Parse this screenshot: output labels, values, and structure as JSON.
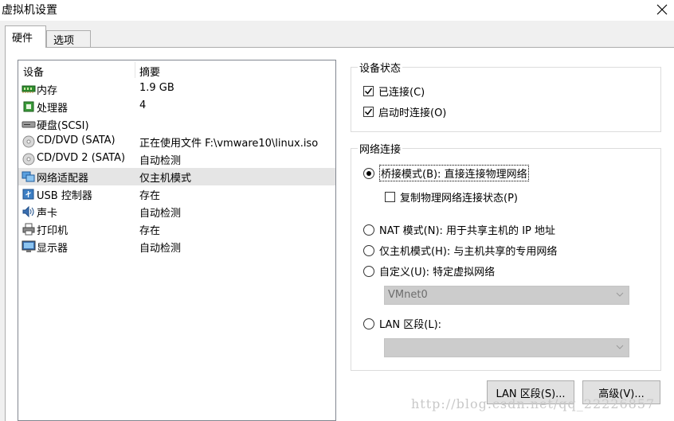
{
  "window": {
    "title": "虚拟机设置"
  },
  "tabs": [
    {
      "label": "硬件"
    },
    {
      "label": "选项"
    }
  ],
  "device_list": {
    "headers": {
      "device": "设备",
      "summary": "摘要"
    },
    "rows": [
      {
        "name": "内存",
        "summary": "1.9 GB",
        "icon": "memory-icon"
      },
      {
        "name": "处理器",
        "summary": "4",
        "icon": "processor-icon"
      },
      {
        "name": "硬盘(SCSI)",
        "summary": "",
        "icon": "hard-disk-icon"
      },
      {
        "name": "CD/DVD (SATA)",
        "summary": "正在使用文件 F:\\vmware10\\linux.iso",
        "icon": "cd-dvd-icon"
      },
      {
        "name": "CD/DVD 2 (SATA)",
        "summary": "自动检测",
        "icon": "cd-dvd-icon"
      },
      {
        "name": "网络适配器",
        "summary": "仅主机模式",
        "icon": "network-adapter-icon"
      },
      {
        "name": "USB 控制器",
        "summary": "存在",
        "icon": "usb-icon"
      },
      {
        "name": "声卡",
        "summary": "自动检测",
        "icon": "sound-card-icon"
      },
      {
        "name": "打印机",
        "summary": "存在",
        "icon": "printer-icon"
      },
      {
        "name": "显示器",
        "summary": "自动检测",
        "icon": "display-icon"
      }
    ],
    "selected_index": 5
  },
  "device_status": {
    "legend": "设备状态",
    "connected_label": "已连接(C)",
    "connected_checked": true,
    "connect_at_power_on_label": "启动时连接(O)",
    "connect_at_power_on_checked": true
  },
  "network_connection": {
    "legend": "网络连接",
    "bridged_label": "桥接模式(B): 直接连接物理网络",
    "replicate_label": "复制物理网络连接状态(P)",
    "replicate_checked": false,
    "nat_label": "NAT 模式(N): 用于共享主机的 IP 地址",
    "host_only_label": "仅主机模式(H): 与主机共享的专用网络",
    "custom_label": "自定义(U): 特定虚拟网络",
    "custom_value": "VMnet0",
    "lan_segment_label": "LAN 区段(L):",
    "lan_segment_value": "",
    "selected": "bridged"
  },
  "buttons": {
    "lan_segments": "LAN 区段(S)...",
    "advanced": "高级(V)..."
  },
  "watermark": "http://blog.csdn.net/qq_22226857"
}
